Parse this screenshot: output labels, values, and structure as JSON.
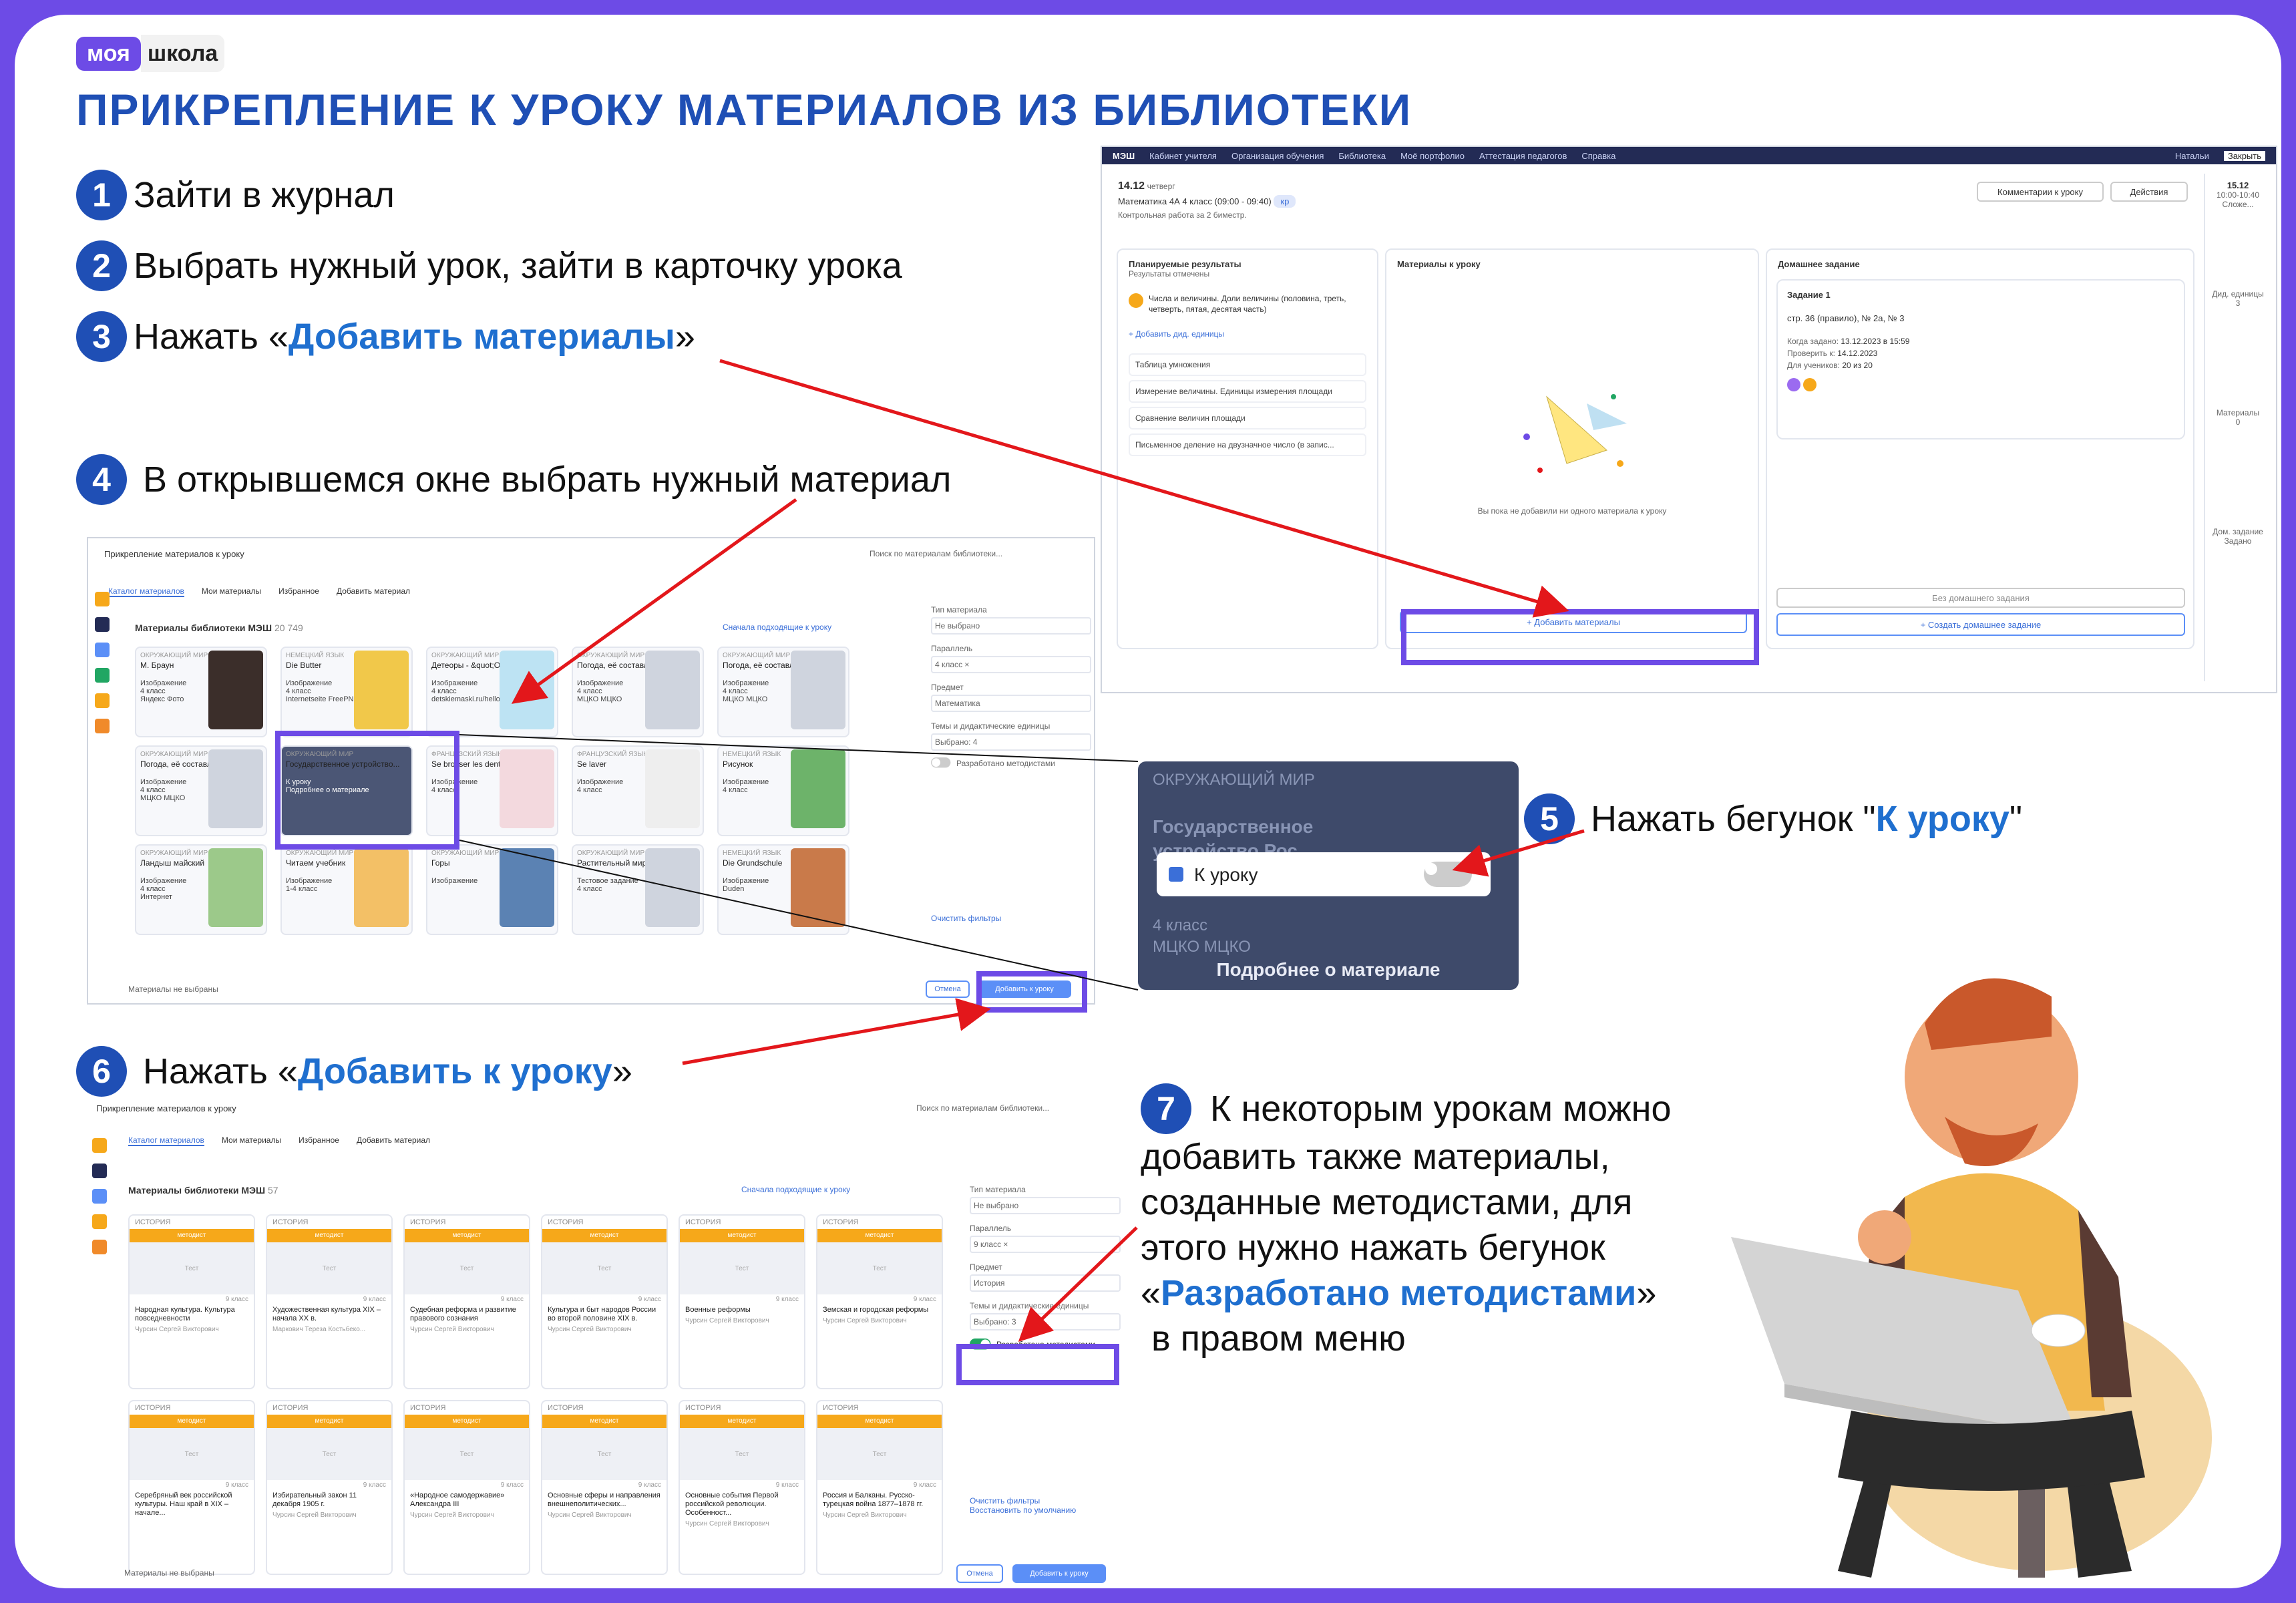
{
  "logo": {
    "part1": "моя",
    "part2": "школа"
  },
  "title": "ПРИКРЕПЛЕНИЕ К УРОКУ МАТЕРИАЛОВ ИЗ БИБЛИОТЕКИ",
  "steps": {
    "s1": {
      "num": "1",
      "text": "Зайти в журнал"
    },
    "s2": {
      "num": "2",
      "text": "Выбрать нужный урок, зайти в карточку урока"
    },
    "s3": {
      "num": "3",
      "pre": "Нажать «",
      "hl": "Добавить материалы",
      "post": "»"
    },
    "s4": {
      "num": "4",
      "text": "В открывшемся окне выбрать нужный материал"
    },
    "s5": {
      "num": "5",
      "pre": "Нажать бегунок \"",
      "hl": "К уроку",
      "post": "\""
    },
    "s6": {
      "num": "6",
      "pre": "Нажать «",
      "hl": "Добавить к уроку",
      "post": "»"
    },
    "s7": {
      "num": "7",
      "line1": "К некоторым урокам можно",
      "line2": "добавить также материалы,",
      "line3": "созданные методистами, для",
      "line4": "этого нужно нажать бегунок",
      "pre": "«",
      "hl": "Разработано методистами",
      "post": "»",
      "line6": "в правом меню"
    }
  },
  "journal": {
    "nav": [
      "МЭШ",
      "Кабинет учителя",
      "Организация обучения",
      "Библиотека",
      "Моё портфолио",
      "Аттестация педагогов",
      "Справка"
    ],
    "user": "Натальи",
    "date": "14.12",
    "weekday": "четверг",
    "lesson": "Математика 4А 4 класс (09:00 - 09:40)",
    "badge": "кр",
    "lesson_sub": "Контрольная работа за 2 биместр.",
    "comment_btn": "Комментарии к уроку",
    "actions_btn": "Действия",
    "planned_title": "Планируемые результаты",
    "planned_sub": "Результаты отмечены",
    "topic": "Числа и величины. Доли величины (половина, треть, четверть, пятая, десятая часть)",
    "add_unit": "+ Добавить дид. единицы",
    "units": [
      "Таблица умножения",
      "Измерение величины. Единицы измерения площади",
      "Сравнение величин площади",
      "Письменное деление на двузначное число (в запис..."
    ],
    "materials_title": "Материалы к уроку",
    "materials_empty": "Вы пока не добавили ни одного материала к уроку",
    "add_materials_btn": "+ Добавить материалы",
    "hw_title": "Домашнее задание",
    "task_title": "Задание 1",
    "task_text": "стр. 36 (правило), № 2а, № 3",
    "given_label": "Когда задано:",
    "given_val": "13.12.2023 в 15:59",
    "check_label": "Проверить к:",
    "check_val": "14.12.2023",
    "students_label": "Для учеников:",
    "students_val": "20 из 20",
    "no_hw_btn": "Без домашнего задания",
    "create_hw_btn": "+ Создать домашнее задание",
    "right_date": "15.12",
    "right_time": "10:00-10:40",
    "right_sub": "Сложе...",
    "right_items": [
      "Дид. единицы",
      "3",
      "Материалы",
      "0",
      "Дом. задание",
      "Задано"
    ],
    "close_btn": "Закрыть"
  },
  "library1": {
    "title": "Прикрепление материалов к уроку",
    "search": "Поиск по материалам библиотеки...",
    "tabs": [
      "Каталог материалов",
      "Мои материалы",
      "Избранное",
      "Добавить материал"
    ],
    "heading": "Материалы библиотеки МЭШ",
    "count": "20 749",
    "sort": "Сначала подходящие к уроку",
    "filters": {
      "type_label": "Тип материала",
      "type_val": "Не выбрано",
      "grade_label": "Параллель",
      "grade_val": "4 класс ×",
      "subject_label": "Предмет",
      "subject_val": "Математика",
      "topics_label": "Темы и дидактические единицы",
      "topics_val": "Выбрано: 4",
      "methodists_label": "Разработано методистами",
      "clear": "Очистить фильтры"
    },
    "cards": [
      {
        "subj": "Окружающий мир",
        "title": "М. Браун",
        "kind": "Изображение",
        "grade": "4 класс",
        "src": "Яндекс Фото"
      },
      {
        "subj": "Немецкий язык",
        "title": "Die Butter",
        "kind": "Изображение",
        "grade": "4 класс",
        "src": "Internetseite FreePNG"
      },
      {
        "subj": "Окружающий мир",
        "title": "Детеоры - &quot;Облачное...",
        "kind": "Изображение",
        "grade": "4 класс",
        "src": "detskiemaski.ru/hello"
      },
      {
        "subj": "Окружающий мир",
        "title": "Погода, её составляющие...",
        "kind": "Изображение",
        "grade": "4 класс",
        "src": "МЦКО МЦКО"
      },
      {
        "subj": "Окружающий мир",
        "title": "Погода, её составляющие...",
        "kind": "Изображение",
        "grade": "4 класс",
        "src": "МЦКО МЦКО"
      },
      {
        "subj": "Окружающий мир",
        "title": "Погода, её составляющие...",
        "kind": "Изображение",
        "grade": "4 класс",
        "src": "МЦКО МЦКО"
      },
      {
        "subj": "Окружающий мир",
        "title": "Государственное устройство...",
        "kind": "К уроку",
        "grade": "",
        "src": "Подробнее о материале"
      },
      {
        "subj": "Французский язык",
        "title": "Se brosser les dents",
        "kind": "Изображение",
        "grade": "4 класс",
        "src": ""
      },
      {
        "subj": "Французский язык",
        "title": "Se laver",
        "kind": "Изображение",
        "grade": "4 класс",
        "src": ""
      },
      {
        "subj": "Немецкий язык",
        "title": "Рисунок",
        "kind": "Изображение",
        "grade": "4 класс",
        "src": ""
      },
      {
        "subj": "Окружающий мир",
        "title": "Ландыш майский",
        "kind": "Изображение",
        "grade": "4 класс",
        "src": "Интернет"
      },
      {
        "subj": "Окружающий мир",
        "title": "Читаем учебник",
        "kind": "Изображение",
        "grade": "1-4 класс",
        "src": ""
      },
      {
        "subj": "Окружающий мир",
        "title": "Горы",
        "kind": "Изображение",
        "grade": "",
        "src": ""
      },
      {
        "subj": "Окружающий мир",
        "title": "Растительный мир",
        "kind": "Тестовое задание",
        "grade": "4 класс",
        "src": ""
      },
      {
        "subj": "Немецкий язык",
        "title": "Die Grundschule",
        "kind": "Изображение",
        "grade": "",
        "src": "Duden"
      }
    ],
    "footer_left": "Материалы не выбраны",
    "cancel": "Отмена",
    "add": "Добавить к уроку"
  },
  "zoom": {
    "subj": "ОКРУЖАЮЩИЙ МИР",
    "title1": "Государственное",
    "title2": "устройство Рос...",
    "toggle_label": "К уроку",
    "grade": "4 класс",
    "src": "МЦКО МЦКО",
    "more": "Подробнее о материале"
  },
  "library2": {
    "title": "Прикрепление материалов к уроку",
    "search": "Поиск по материалам библиотеки...",
    "tabs": [
      "Каталог материалов",
      "Мои материалы",
      "Избранное",
      "Добавить материал"
    ],
    "heading": "Материалы библиотеки МЭШ",
    "count": "57",
    "sort": "Сначала подходящие к уроку",
    "filters": {
      "type_label": "Тип материала",
      "type_val": "Не выбрано",
      "grade_label": "Параллель",
      "grade_val": "9 класс ×",
      "subject_label": "Предмет",
      "subject_val": "История",
      "topics_label": "Темы и дидактические единицы",
      "topics_val": "Выбрано: 3",
      "methodists_label": "Разработано методистами",
      "clear": "Очистить фильтры",
      "restore": "Восстановить по умолчанию"
    },
    "tag": "методист",
    "ph": "Тест",
    "cards": [
      {
        "title": "Народная культура. Культура повседневности",
        "author": "Чурсин Сергей Викторович"
      },
      {
        "title": "Художественная культура XIX – начала XX в.",
        "author": "Маркович Тереза Костьбеко..."
      },
      {
        "title": "Судебная реформа и развитие правового сознания",
        "author": "Чурсин Сергей Викторович"
      },
      {
        "title": "Культура и быт народов России во второй половине XIX в.",
        "author": "Чурсин Сергей Викторович"
      },
      {
        "title": "Военные реформы",
        "author": "Чурсин Сергей Викторович"
      },
      {
        "title": "Земская и городская реформы",
        "author": "Чурсин Сергей Викторович"
      },
      {
        "title": "Серебряный век российской культуры. Наш край в XIX – начале...",
        "author": ""
      },
      {
        "title": "Избирательный закон 11 декабря 1905 г.",
        "author": "Чурсин Сергей Викторович"
      },
      {
        "title": "«Народное самодержавие» Александра III",
        "author": "Чурсин Сергей Викторович"
      },
      {
        "title": "Основные сферы и направления внешнеполитических...",
        "author": "Чурсин Сергей Викторович"
      },
      {
        "title": "Основные события Первой российской революции. Особенност...",
        "author": "Чурсин Сергей Викторович"
      },
      {
        "title": "Россия и Балканы. Русско-турецкая война 1877–1878 гг.",
        "author": "Чурсин Сергей Викторович"
      }
    ],
    "subj": "ИСТОРИЯ",
    "grade": "9 класс",
    "footer_left": "Материалы не выбраны",
    "cancel": "Отмена",
    "add": "Добавить к уроку"
  },
  "colors": {
    "accent": "#6d4be6",
    "title_blue": "#1f4fb5",
    "link_blue": "#1f6fcf",
    "arrow_red": "#e3171b"
  }
}
